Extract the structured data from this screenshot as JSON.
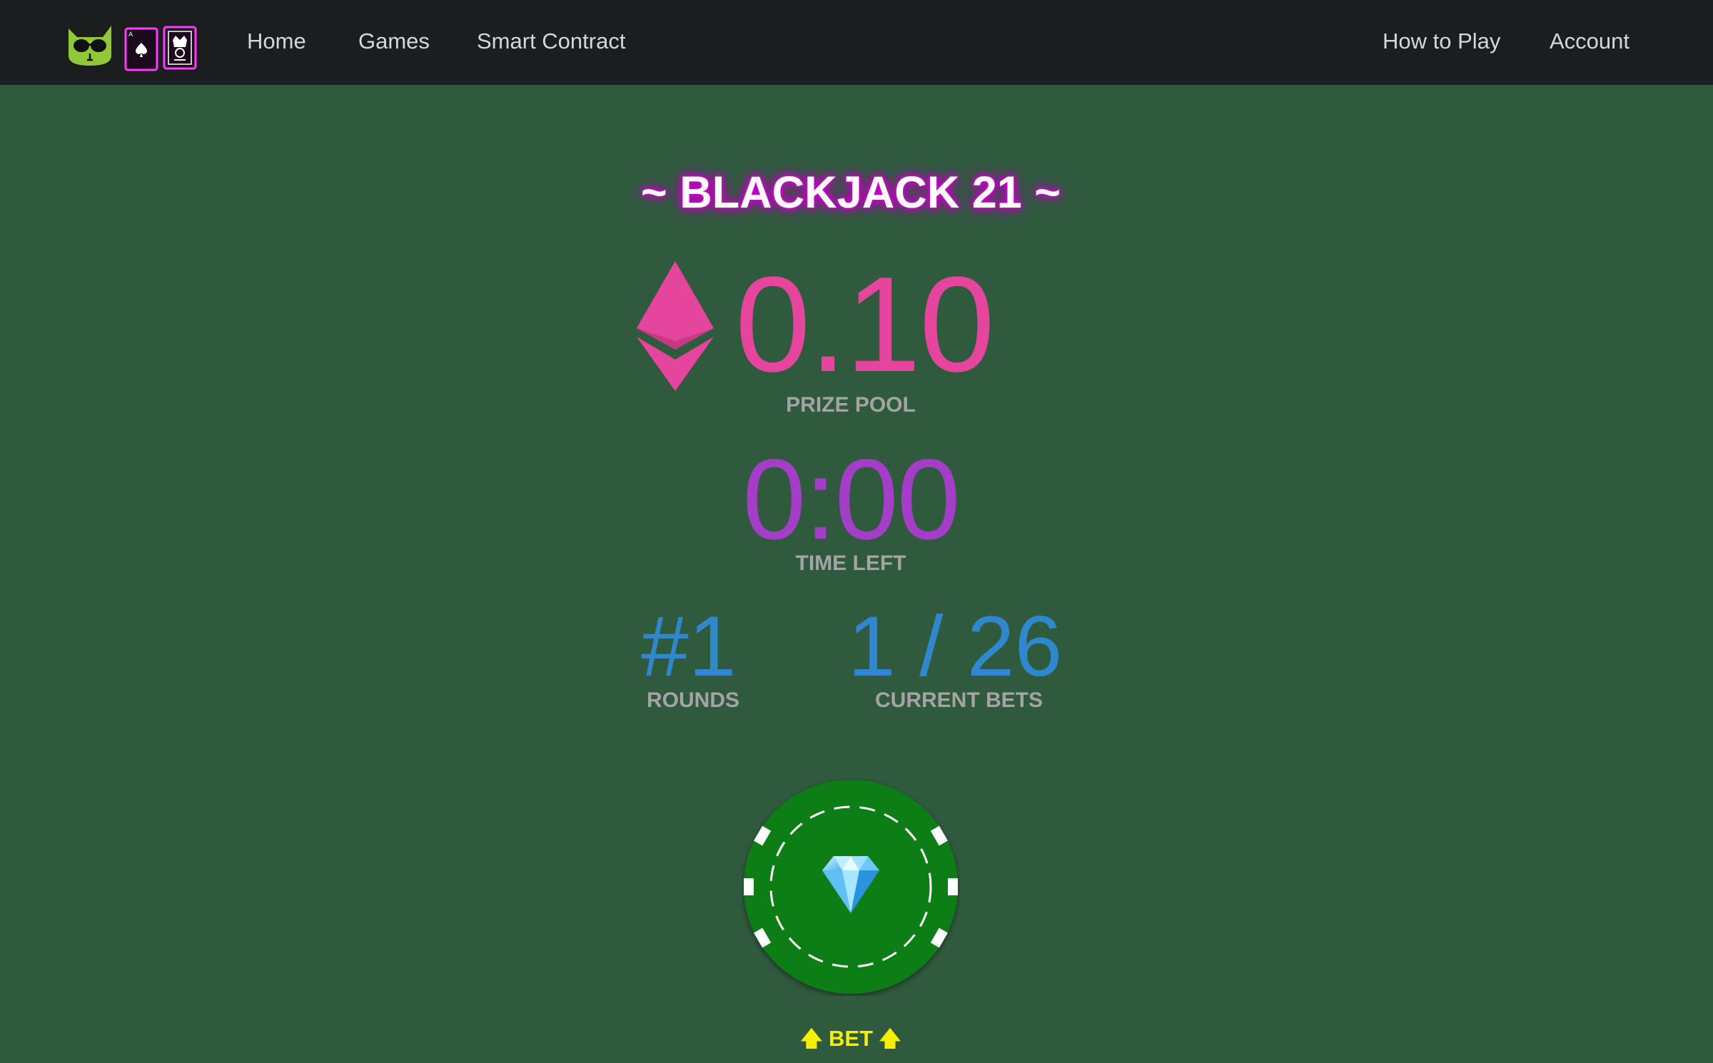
{
  "nav": {
    "links": [
      "Home",
      "Games",
      "Smart Contract"
    ],
    "right_links": [
      "How to Play",
      "Account"
    ]
  },
  "icons": {
    "logo": "cool-cat-with-cards-logo",
    "currency": "ethereum-icon",
    "chip": "poker-chip-diamond-icon"
  },
  "game": {
    "title": "~ BLACKJACK 21 ~",
    "prize_pool_value": "0.10",
    "prize_pool_label": "PRIZE POOL",
    "time_left_value": "0:00",
    "time_left_label": "TIME LEFT",
    "rounds_value": "#1",
    "rounds_label": "ROUNDS",
    "current_bets_value": "1 / 26",
    "current_bets_label": "CURRENT BETS"
  },
  "bet": {
    "arrow_left": "🡅",
    "label": "BET",
    "arrow_right": "🡅"
  },
  "colors": {
    "background": "#2f5a3e",
    "navbar": "#1c1d1f",
    "prize": "#e5459d",
    "time": "#a43dc7",
    "stats": "#2f87cc",
    "bet": "#f4f000",
    "chip": "#0f7d16"
  }
}
